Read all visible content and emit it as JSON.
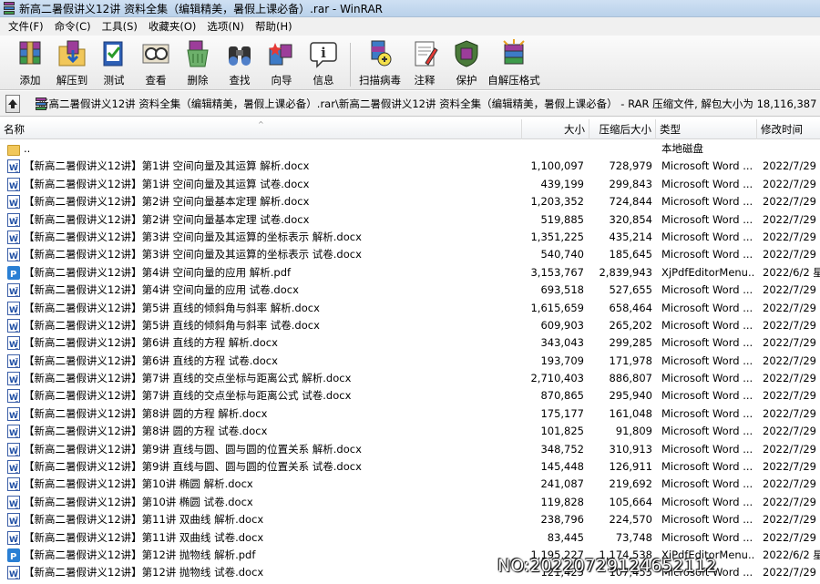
{
  "window": {
    "title": "新高二暑假讲义12讲 资料全集（编辑精美，暑假上课必备）.rar - WinRAR"
  },
  "menu": [
    "文件(F)",
    "命令(C)",
    "工具(S)",
    "收藏夹(O)",
    "选项(N)",
    "帮助(H)"
  ],
  "toolbar": [
    {
      "label": "添加",
      "icon": "add-archive-icon"
    },
    {
      "label": "解压到",
      "icon": "extract-to-icon"
    },
    {
      "label": "测试",
      "icon": "test-icon"
    },
    {
      "label": "查看",
      "icon": "view-icon"
    },
    {
      "label": "删除",
      "icon": "delete-icon"
    },
    {
      "label": "查找",
      "icon": "find-icon"
    },
    {
      "label": "向导",
      "icon": "wizard-icon"
    },
    {
      "label": "信息",
      "icon": "info-icon"
    },
    {
      "label": "扫描病毒",
      "icon": "virus-scan-icon"
    },
    {
      "label": "注释",
      "icon": "comment-icon"
    },
    {
      "label": "保护",
      "icon": "protect-icon"
    },
    {
      "label": "自解压格式",
      "icon": "sfx-icon"
    }
  ],
  "path": {
    "text": "新高二暑假讲义12讲 资料全集（编辑精美，暑假上课必备）.rar\\新高二暑假讲义12讲 资料全集（编辑精美，暑假上课必备） - RAR 压缩文件, 解包大小为 18,116,387 字节"
  },
  "columns": {
    "name": "名称",
    "size": "大小",
    "packed": "压缩后大小",
    "type": "类型",
    "modified": "修改时间"
  },
  "files": [
    {
      "name": "..",
      "size": "",
      "packed": "",
      "type": "本地磁盘",
      "modified": "",
      "kind": "folder"
    },
    {
      "name": "【新高二暑假讲义12讲】第1讲 空间向量及其运算 解析.docx",
      "size": "1,100,097",
      "packed": "728,979",
      "type": "Microsoft Word ...",
      "modified": "2022/7/29 星",
      "kind": "word"
    },
    {
      "name": "【新高二暑假讲义12讲】第1讲 空间向量及其运算 试卷.docx",
      "size": "439,199",
      "packed": "299,843",
      "type": "Microsoft Word ...",
      "modified": "2022/7/29 星",
      "kind": "word"
    },
    {
      "name": "【新高二暑假讲义12讲】第2讲 空间向量基本定理 解析.docx",
      "size": "1,203,352",
      "packed": "724,844",
      "type": "Microsoft Word ...",
      "modified": "2022/7/29 星",
      "kind": "word"
    },
    {
      "name": "【新高二暑假讲义12讲】第2讲 空间向量基本定理 试卷.docx",
      "size": "519,885",
      "packed": "320,854",
      "type": "Microsoft Word ...",
      "modified": "2022/7/29 星",
      "kind": "word"
    },
    {
      "name": "【新高二暑假讲义12讲】第3讲 空间向量及其运算的坐标表示 解析.docx",
      "size": "1,351,225",
      "packed": "435,214",
      "type": "Microsoft Word ...",
      "modified": "2022/7/29 星",
      "kind": "word"
    },
    {
      "name": "【新高二暑假讲义12讲】第3讲 空间向量及其运算的坐标表示 试卷.docx",
      "size": "540,740",
      "packed": "185,645",
      "type": "Microsoft Word ...",
      "modified": "2022/7/29 星",
      "kind": "word"
    },
    {
      "name": "【新高二暑假讲义12讲】第4讲 空间向量的应用 解析.pdf",
      "size": "3,153,767",
      "packed": "2,839,943",
      "type": "XjPdfEditorMenu...",
      "modified": "2022/6/2 星",
      "kind": "pdf"
    },
    {
      "name": "【新高二暑假讲义12讲】第4讲 空间向量的应用 试卷.docx",
      "size": "693,518",
      "packed": "527,655",
      "type": "Microsoft Word ...",
      "modified": "2022/7/29 星",
      "kind": "word"
    },
    {
      "name": "【新高二暑假讲义12讲】第5讲 直线的倾斜角与斜率 解析.docx",
      "size": "1,615,659",
      "packed": "658,464",
      "type": "Microsoft Word ...",
      "modified": "2022/7/29 星",
      "kind": "word"
    },
    {
      "name": "【新高二暑假讲义12讲】第5讲 直线的倾斜角与斜率 试卷.docx",
      "size": "609,903",
      "packed": "265,202",
      "type": "Microsoft Word ...",
      "modified": "2022/7/29 星",
      "kind": "word"
    },
    {
      "name": "【新高二暑假讲义12讲】第6讲 直线的方程 解析.docx",
      "size": "343,043",
      "packed": "299,285",
      "type": "Microsoft Word ...",
      "modified": "2022/7/29 星",
      "kind": "word"
    },
    {
      "name": "【新高二暑假讲义12讲】第6讲 直线的方程 试卷.docx",
      "size": "193,709",
      "packed": "171,978",
      "type": "Microsoft Word ...",
      "modified": "2022/7/29 星",
      "kind": "word"
    },
    {
      "name": "【新高二暑假讲义12讲】第7讲 直线的交点坐标与距离公式 解析.docx",
      "size": "2,710,403",
      "packed": "886,807",
      "type": "Microsoft Word ...",
      "modified": "2022/7/29 星",
      "kind": "word"
    },
    {
      "name": "【新高二暑假讲义12讲】第7讲 直线的交点坐标与距离公式 试卷.docx",
      "size": "870,865",
      "packed": "295,940",
      "type": "Microsoft Word ...",
      "modified": "2022/7/29 星",
      "kind": "word"
    },
    {
      "name": "【新高二暑假讲义12讲】第8讲 圆的方程 解析.docx",
      "size": "175,177",
      "packed": "161,048",
      "type": "Microsoft Word ...",
      "modified": "2022/7/29 星",
      "kind": "word"
    },
    {
      "name": "【新高二暑假讲义12讲】第8讲 圆的方程 试卷.docx",
      "size": "101,825",
      "packed": "91,809",
      "type": "Microsoft Word ...",
      "modified": "2022/7/29 星",
      "kind": "word"
    },
    {
      "name": "【新高二暑假讲义12讲】第9讲 直线与圆、圆与圆的位置关系 解析.docx",
      "size": "348,752",
      "packed": "310,913",
      "type": "Microsoft Word ...",
      "modified": "2022/7/29 星",
      "kind": "word"
    },
    {
      "name": "【新高二暑假讲义12讲】第9讲 直线与圆、圆与圆的位置关系 试卷.docx",
      "size": "145,448",
      "packed": "126,911",
      "type": "Microsoft Word ...",
      "modified": "2022/7/29 星",
      "kind": "word"
    },
    {
      "name": "【新高二暑假讲义12讲】第10讲 椭圆 解析.docx",
      "size": "241,087",
      "packed": "219,692",
      "type": "Microsoft Word ...",
      "modified": "2022/7/29 星",
      "kind": "word"
    },
    {
      "name": "【新高二暑假讲义12讲】第10讲 椭圆 试卷.docx",
      "size": "119,828",
      "packed": "105,664",
      "type": "Microsoft Word ...",
      "modified": "2022/7/29 星",
      "kind": "word"
    },
    {
      "name": "【新高二暑假讲义12讲】第11讲 双曲线 解析.docx",
      "size": "238,796",
      "packed": "224,570",
      "type": "Microsoft Word ...",
      "modified": "2022/7/29 星",
      "kind": "word"
    },
    {
      "name": "【新高二暑假讲义12讲】第11讲 双曲线 试卷.docx",
      "size": "83,445",
      "packed": "73,748",
      "type": "Microsoft Word ...",
      "modified": "2022/7/29 星",
      "kind": "word"
    },
    {
      "name": "【新高二暑假讲义12讲】第12讲 抛物线 解析.pdf",
      "size": "1,195,227",
      "packed": "1,174,538",
      "type": "XjPdfEditorMenu...",
      "modified": "2022/6/2 星",
      "kind": "pdf"
    },
    {
      "name": "【新高二暑假讲义12讲】第12讲 抛物线 试卷.docx",
      "size": "121,425",
      "packed": "107,455",
      "type": "Microsoft Word ...",
      "modified": "2022/7/29 星",
      "kind": "word"
    }
  ],
  "watermark": "NO:20220729124652112"
}
